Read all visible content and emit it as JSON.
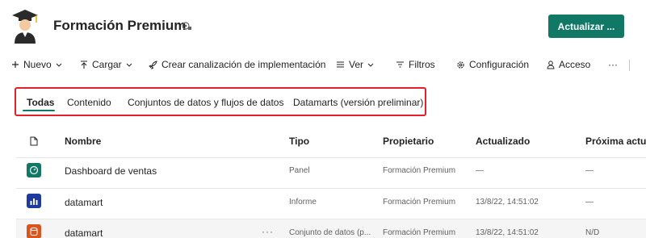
{
  "workspace": {
    "title": "Formación Premium",
    "update_button": "Actualizar ..."
  },
  "toolbar": {
    "new": "Nuevo",
    "upload": "Cargar",
    "pipeline": "Crear canalización de implementación",
    "view": "Ver",
    "filters": "Filtros",
    "settings": "Configuración",
    "access": "Acceso",
    "more": "···"
  },
  "tabs": [
    {
      "label": "Todas",
      "active": true
    },
    {
      "label": "Contenido",
      "active": false
    },
    {
      "label": "Conjuntos de datos y flujos de datos",
      "active": false
    },
    {
      "label": "Datamarts (versión preliminar)",
      "active": false
    }
  ],
  "table": {
    "headers": {
      "name": "Nombre",
      "type": "Tipo",
      "owner": "Propietario",
      "updated": "Actualizado",
      "next": "Próxima actua"
    },
    "rows": [
      {
        "name": "Dashboard de ventas",
        "type": "Panel",
        "owner": "Formación Premium",
        "updated": "—",
        "next": "—",
        "icon": "dashboard-icon",
        "color": "#117865"
      },
      {
        "name": "datamart",
        "type": "Informe",
        "owner": "Formación Premium",
        "updated": "13/8/22, 14:51:02",
        "next": "—",
        "icon": "report-icon",
        "color": "#1e3a9f"
      },
      {
        "name": "datamart",
        "type": "Conjunto de datos (p...",
        "owner": "Formación Premium",
        "updated": "13/8/22, 14:51:02",
        "next": "N/D",
        "icon": "dataset-icon",
        "color": "#d9541e"
      }
    ]
  },
  "colors": {
    "accent": "#117865",
    "highlight_frame": "#e3202b"
  }
}
